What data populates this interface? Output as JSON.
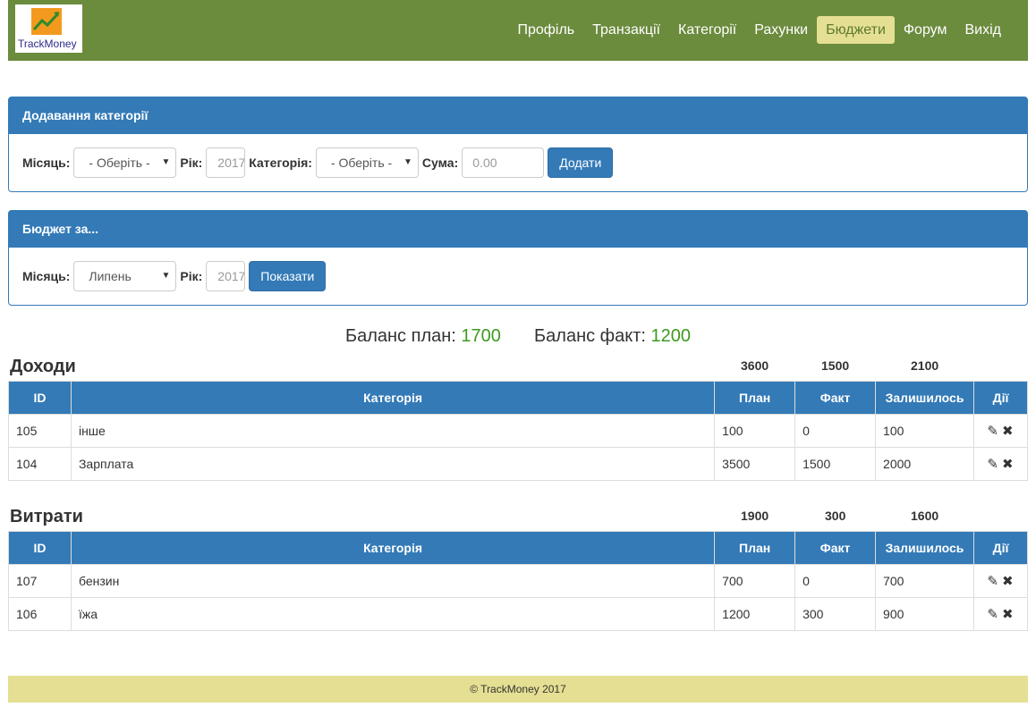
{
  "brand": {
    "logo_text": "TrackMoney"
  },
  "nav": {
    "items": [
      "Профіль",
      "Транзакції",
      "Категорії",
      "Рахунки",
      "Бюджети",
      "Форум",
      "Вихід"
    ],
    "active": "Бюджети"
  },
  "add_panel": {
    "title": "Додавання категорії",
    "month_label": "Місяць:",
    "month_value": "- Оберіть -",
    "year_label": "Рік:",
    "year_value": "2017",
    "category_label": "Категорія:",
    "category_value": "- Оберіть -",
    "sum_label": "Сума:",
    "sum_placeholder": "0.00",
    "button": "Додати"
  },
  "budget_panel": {
    "title": "Бюджет за...",
    "month_label": "Місяць:",
    "month_value": "Липень",
    "year_label": "Рік:",
    "year_value": "2017",
    "button": "Показати"
  },
  "balance": {
    "plan_label": "Баланс план:",
    "plan_value": "1700",
    "fact_label": "Баланс факт:",
    "fact_value": "1200"
  },
  "columns": [
    "ID",
    "Категорія",
    "План",
    "Факт",
    "Залишилось",
    "Дії"
  ],
  "income": {
    "title": "Доходи",
    "totals": {
      "plan": "3600",
      "fact": "1500",
      "left": "2100"
    },
    "rows": [
      {
        "id": "105",
        "category": "інше",
        "plan": "100",
        "fact": "0",
        "left": "100"
      },
      {
        "id": "104",
        "category": "Зарплата",
        "plan": "3500",
        "fact": "1500",
        "left": "2000"
      }
    ]
  },
  "expenses": {
    "title": "Витрати",
    "totals": {
      "plan": "1900",
      "fact": "300",
      "left": "1600"
    },
    "rows": [
      {
        "id": "107",
        "category": "бензин",
        "plan": "700",
        "fact": "0",
        "left": "700"
      },
      {
        "id": "106",
        "category": "їжа",
        "plan": "1200",
        "fact": "300",
        "left": "900"
      }
    ]
  },
  "icons": {
    "edit": "edit-icon",
    "delete": "delete-icon",
    "caret": "caret-down-icon"
  },
  "colors": {
    "navbar": "#6b8b3d",
    "accent": "#337ab7",
    "active_nav": "#e5df93",
    "balance_value": "#3c9a1e"
  },
  "footer": {
    "text": "© TrackMoney 2017"
  }
}
